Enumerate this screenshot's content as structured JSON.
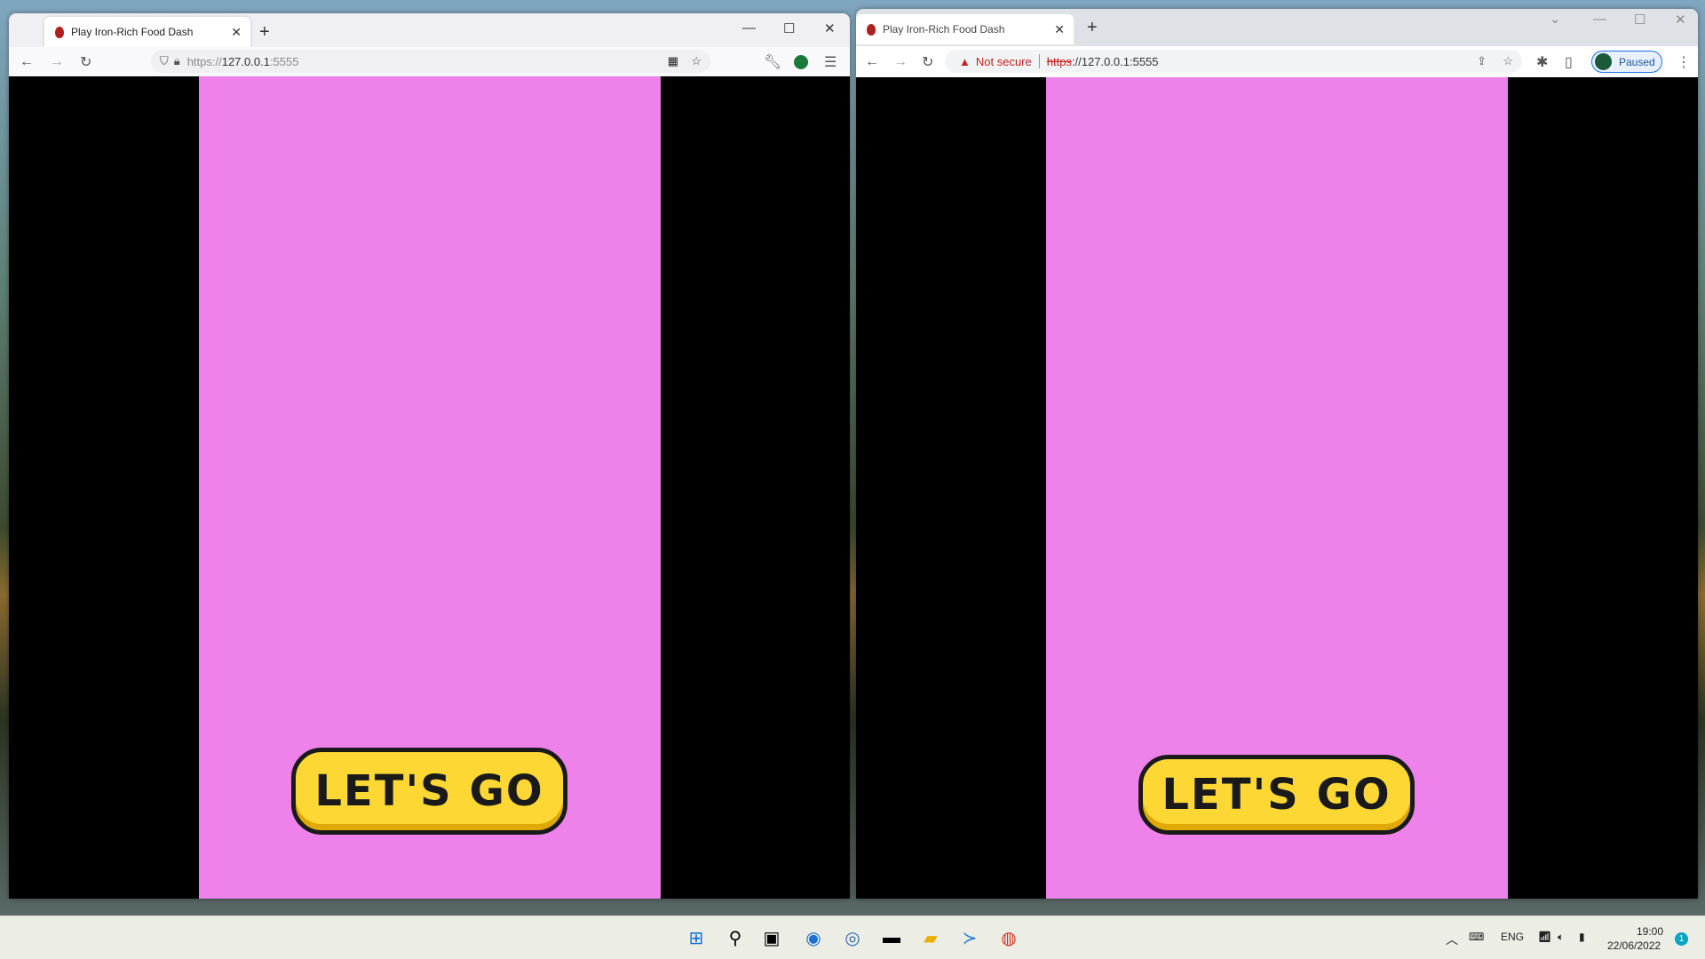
{
  "left_browser": {
    "tab_title": "Play Iron-Rich Food Dash",
    "url_prefix": "https://",
    "url_host": "127.0.0.1",
    "url_port": ":5555",
    "button_label": "LET'S GO"
  },
  "right_browser": {
    "tab_title": "Play Iron-Rich Food Dash",
    "security": "Not secure",
    "url_scheme": "https",
    "url_rest": "://127.0.0.1:5555",
    "profile_status": "Paused",
    "button_label": "LET'S GO"
  },
  "taskbar": {
    "language": "ENG",
    "time": "19:00",
    "date": "22/06/2022",
    "notifications": "1"
  },
  "colors": {
    "game_bg": "#ee82ea",
    "button": "#fdd835"
  }
}
